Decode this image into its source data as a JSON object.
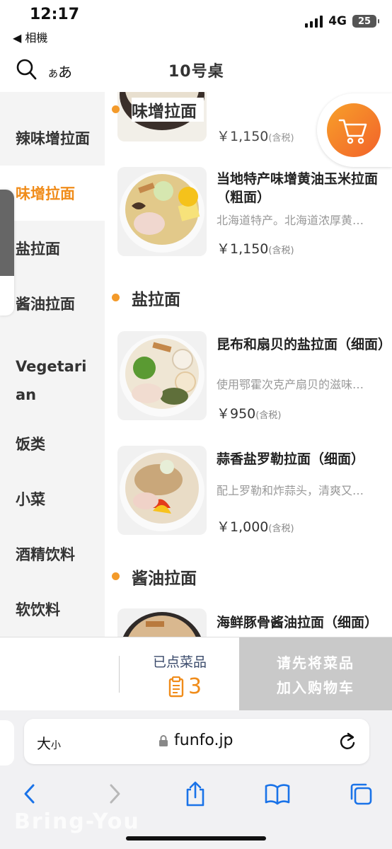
{
  "status": {
    "time": "12:17",
    "back_app": "◀ 相機",
    "network": "4G",
    "battery": "25"
  },
  "header": {
    "font_toggle_big": "あ",
    "font_toggle_small": "あ",
    "table": "10号桌"
  },
  "sidebar": {
    "items": [
      {
        "label": "辣味增拉面",
        "active": false
      },
      {
        "label": "味增拉面",
        "active": true
      },
      {
        "label": "盐拉面",
        "active": false
      },
      {
        "label": "酱油拉面",
        "active": false
      },
      {
        "label": "Vegetarian",
        "active": false
      },
      {
        "label": "饭类",
        "active": false
      },
      {
        "label": "小菜",
        "active": false
      },
      {
        "label": "酒精饮料",
        "active": false
      },
      {
        "label": "软饮料",
        "active": false
      }
    ]
  },
  "menu": {
    "top_partial_price": "￥1,150",
    "top_partial_tax": "(含税)",
    "sections": [
      {
        "title": "味增拉面",
        "items": [
          {
            "name": "当地特产味增黄油玉米拉面（粗面）",
            "desc": "北海道特产。北海道浓厚黄…",
            "price": "￥1,150",
            "tax": "(含税)"
          }
        ]
      },
      {
        "title": "盐拉面",
        "items": [
          {
            "name": "昆布和扇贝的盐拉面（细面）",
            "desc": "使用鄂霍次克产扇贝的滋味…",
            "price": "￥950",
            "tax": "(含税)"
          },
          {
            "name": "蒜香盐罗勒拉面（细面）",
            "desc": "配上罗勒和炸蒜头，清爽又…",
            "price": "￥1,000",
            "tax": "(含税)"
          }
        ]
      },
      {
        "title": "酱油拉面",
        "items": [
          {
            "name": "海鲜豚骨酱油拉面（细面）",
            "desc": "",
            "price": "",
            "tax": ""
          }
        ]
      }
    ]
  },
  "order_bar": {
    "ordered_label": "已点菜品",
    "ordered_count": "3",
    "checkout_line1": "请先将菜品",
    "checkout_line2": "加入购物车"
  },
  "browser": {
    "size_big": "大",
    "size_small": "小",
    "url": "funfo.jp"
  },
  "watermark": "Bring-You",
  "colors": {
    "accent": "#f08c1a",
    "cart_gradient_start": "#f7a02a",
    "cart_gradient_end": "#f2622a",
    "checkout_disabled": "#c9c9c9",
    "ios_blue": "#1a73e8"
  }
}
